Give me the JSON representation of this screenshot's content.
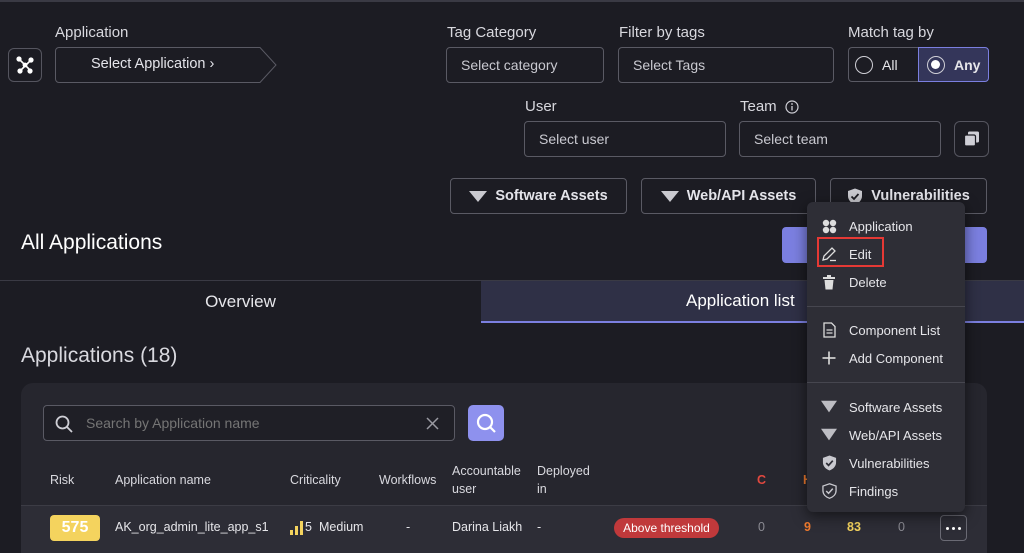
{
  "filters": {
    "application_label": "Application",
    "application_placeholder": "Select Application ›",
    "tag_category_label": "Tag Category",
    "tag_category_placeholder": "Select category",
    "filter_tags_label": "Filter by tags",
    "filter_tags_placeholder": "Select Tags",
    "match_tag_label": "Match tag by",
    "match_all": "All",
    "match_any": "Any",
    "user_label": "User",
    "user_placeholder": "Select user",
    "team_label": "Team",
    "team_placeholder": "Select team"
  },
  "asset_buttons": {
    "software": "Software Assets",
    "webapi": "Web/API Assets",
    "vulnerabilities": "Vulnerabilities"
  },
  "page_title": "All Applications",
  "tabs": {
    "overview": "Overview",
    "application_list": "Application list"
  },
  "applications": {
    "heading": "Applications (18)",
    "search_placeholder": "Search by Application name"
  },
  "table": {
    "headers": {
      "risk": "Risk",
      "app_name": "Application name",
      "criticality": "Criticality",
      "workflows": "Workflows",
      "accountable_user_1": "Accountable",
      "accountable_user_2": "user",
      "deployed_1": "Deployed",
      "deployed_2": "in",
      "c": "C",
      "h": "H"
    },
    "row": {
      "risk": "575",
      "app_name": "AK_org_admin_lite_app_s1",
      "criticality_level": "5",
      "criticality_label": "Medium",
      "workflows": "-",
      "accountable_user": "Darina Liakh",
      "deployed_in": "-",
      "threshold": "Above threshold",
      "c": "0",
      "h": "9",
      "m": "83",
      "l": "0"
    }
  },
  "context_menu": {
    "application": "Application",
    "edit": "Edit",
    "delete": "Delete",
    "component_list": "Component List",
    "add_component": "Add Component",
    "software_assets": "Software Assets",
    "webapi_assets": "Web/API Assets",
    "vulnerabilities": "Vulnerabilities",
    "findings": "Findings"
  },
  "colors": {
    "accent": "#7b7fe0",
    "risk_badge": "#f4d35e",
    "threshold": "#c0393b",
    "edit_highlight": "#e53935"
  }
}
